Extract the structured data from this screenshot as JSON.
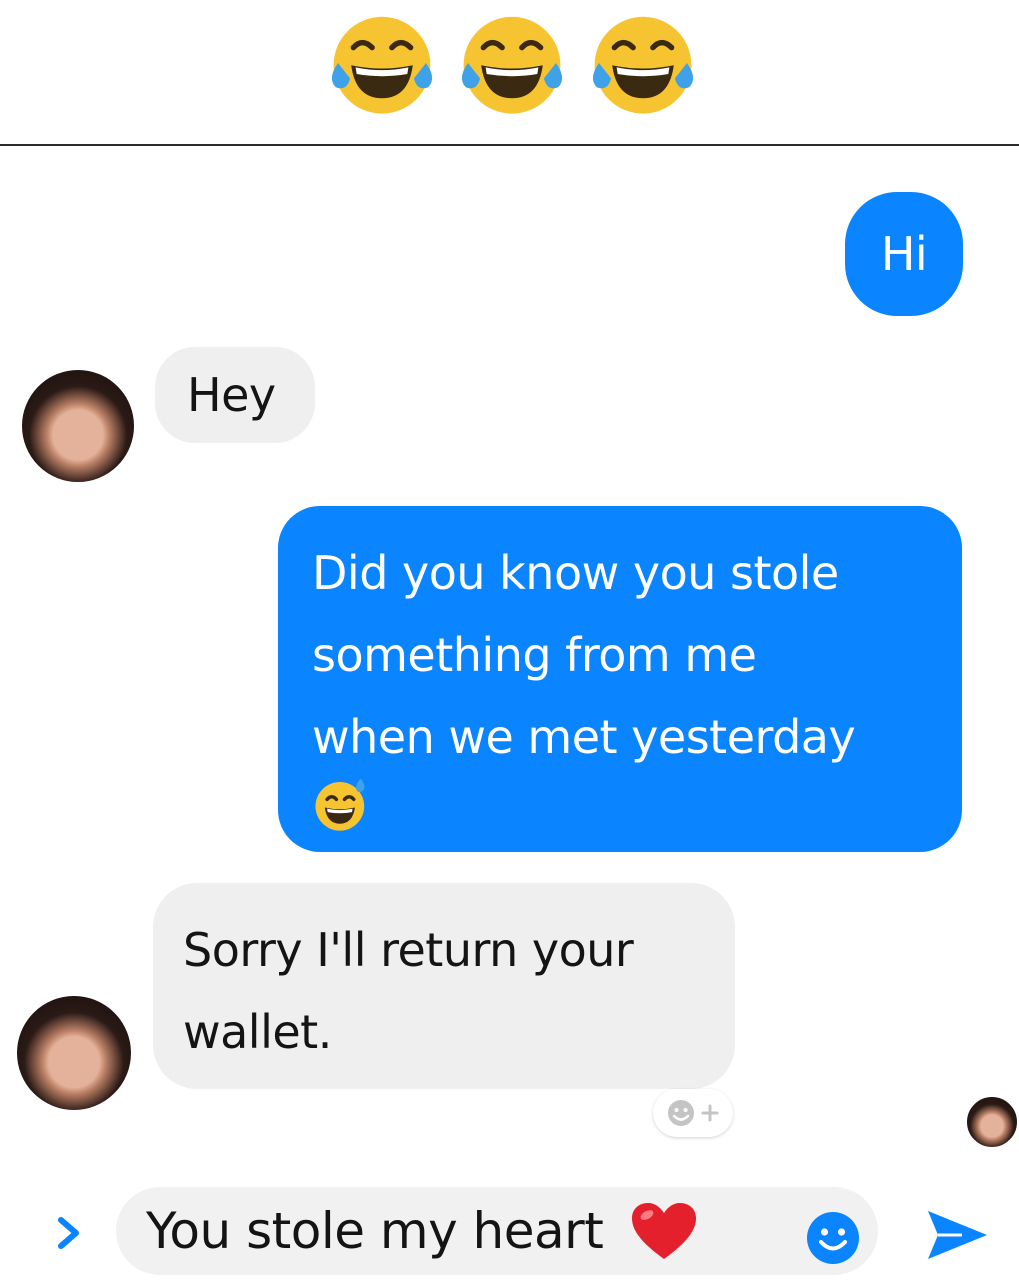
{
  "header": {
    "emojis": [
      "face-with-tears-of-joy-icon",
      "face-with-tears-of-joy-icon",
      "face-with-tears-of-joy-icon"
    ]
  },
  "messages": [
    {
      "sender": "me",
      "text": "Hi"
    },
    {
      "sender": "contact",
      "text": "Hey"
    },
    {
      "sender": "me",
      "lines": [
        "Did you know you stole",
        "something from me",
        "when we met yesterday"
      ],
      "emoji": "grinning-face-with-sweat-icon"
    },
    {
      "sender": "contact",
      "lines": [
        "Sorry I'll return your",
        "wallet."
      ]
    }
  ],
  "composer": {
    "text": "You stole my heart",
    "emoji": "red-heart-icon"
  },
  "colors": {
    "outgoing_bubble": "#0a84ff",
    "incoming_bubble": "#efefef",
    "accent": "#0a84ff"
  }
}
